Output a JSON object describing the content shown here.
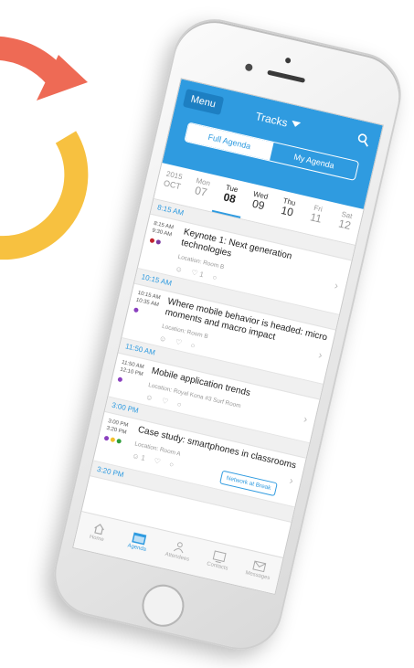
{
  "colors": {
    "accent": "#2f9be0",
    "arc_red": "#ee6a55",
    "arc_yellow": "#f7c140"
  },
  "header": {
    "menu_label": "Menu",
    "title": "Tracks",
    "segments": [
      "Full Agenda",
      "My Agenda"
    ],
    "active_segment": "Full Agenda"
  },
  "days": [
    {
      "top": "2015",
      "bottom": "OCT"
    },
    {
      "top": "Mon",
      "bottom": "07"
    },
    {
      "top": "Tue",
      "bottom": "08"
    },
    {
      "top": "Wed",
      "bottom": "09"
    },
    {
      "top": "Thu",
      "bottom": "10"
    },
    {
      "top": "Fri",
      "bottom": "11"
    },
    {
      "top": "Sat",
      "bottom": "12"
    }
  ],
  "selected_day": "08",
  "sections": [
    {
      "time": "8:15 AM",
      "session": {
        "start": "8:15 AM",
        "end": "9:30 AM",
        "title": "Keynote 1: Next generation technologies",
        "location": "Location: Room B",
        "like_count": "1",
        "dots": [
          "#c0242e",
          "#7b3aa0"
        ]
      }
    },
    {
      "time": "10:15 AM",
      "session": {
        "start": "10:15 AM",
        "end": "10:35 AM",
        "title": "Where mobile behavior is headed: micro moments and macro impact",
        "location": "Location: Room B",
        "dots": [
          "#8a3fbf"
        ]
      }
    },
    {
      "time": "11:50 AM",
      "session": {
        "start": "11:50 AM",
        "end": "12:10 PM",
        "title": "Mobile application trends",
        "location": "Location: Royal Kona #3 Surf Room",
        "dots": [
          "#8a3fbf"
        ]
      }
    },
    {
      "time": "3:00 PM",
      "session": {
        "start": "3:00 PM",
        "end": "3:20 PM",
        "title": "Case study: smartphones in classrooms",
        "location": "Location: Room A",
        "person_count": "1",
        "dots": [
          "#8a3fbf",
          "#f2c12e",
          "#2e9e3b"
        ],
        "button_label": "Network at Break"
      }
    },
    {
      "time": "3:20 PM"
    }
  ],
  "tabs": [
    {
      "label": "Home",
      "icon": "home-icon"
    },
    {
      "label": "Agenda",
      "icon": "calendar-icon"
    },
    {
      "label": "Attendees",
      "icon": "people-icon"
    },
    {
      "label": "Contacts",
      "icon": "contacts-icon"
    },
    {
      "label": "Messages",
      "icon": "mail-icon"
    }
  ],
  "active_tab": "Agenda"
}
